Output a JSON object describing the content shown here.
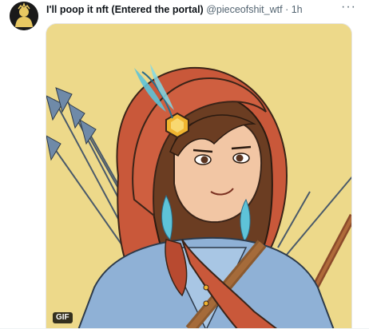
{
  "tweet": {
    "display_name": "I'll poop it nft (Entered the portal)",
    "handle": "@pieceofshit_wtf",
    "separator": "·",
    "time": "1h",
    "more_label": "···"
  },
  "media": {
    "badge": "GIF",
    "background_color": "#edd98a"
  }
}
